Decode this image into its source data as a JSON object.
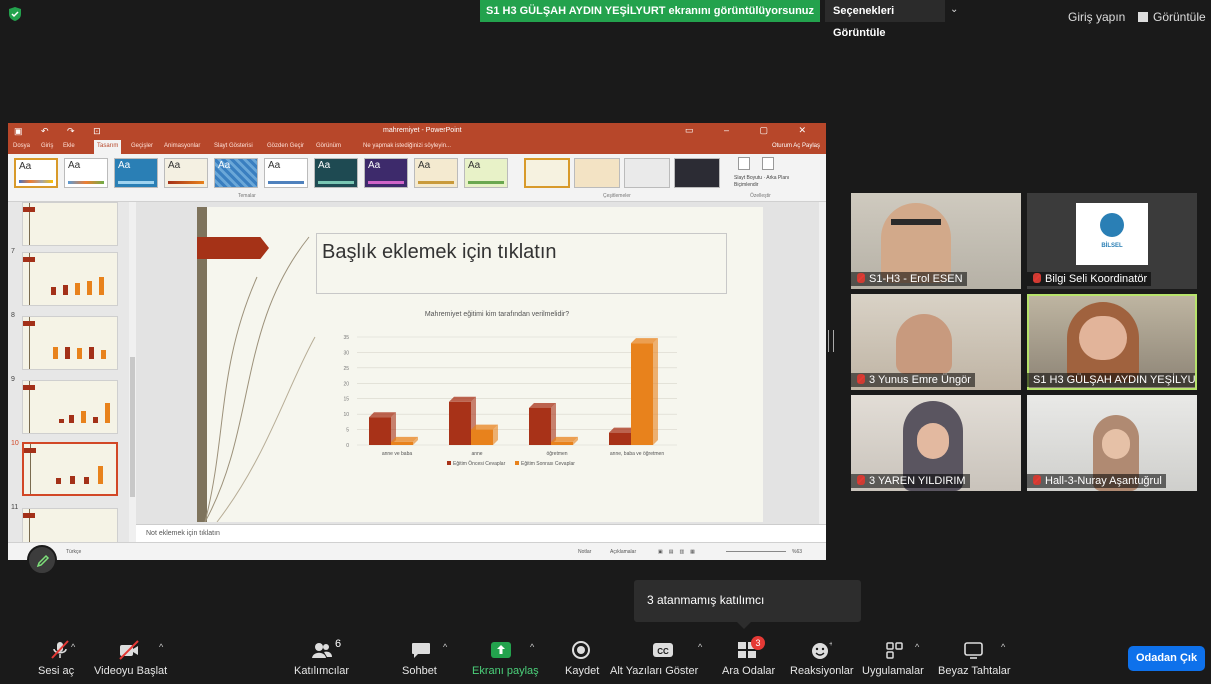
{
  "topbar": {
    "share_banner": "S1 H3 GÜLŞAH AYDIN YEŞİLYURT ekranını görüntülüyorsunuz",
    "options_label": "Seçenekleri Görüntüle",
    "signin_label": "Giriş yapın",
    "view_label": "Görüntüle"
  },
  "ppt": {
    "window_title": "mahremiyet - PowerPoint",
    "tabs": [
      "Dosya",
      "Giriş",
      "Ekle",
      "Tasarım",
      "Geçişler",
      "Animasyonlar",
      "Slayt Gösterisi",
      "Gözden Geçir",
      "Görünüm",
      "Ne yapmak istediğinizi söyleyin..."
    ],
    "active_tab": "Tasarım",
    "tabs_right": "Oturum Aç  Paylaş",
    "theme_label": "Aa",
    "group_themes": "Temalar",
    "group_variants": "Çeşitlemeler",
    "group_customize": "Özelleştir",
    "customize_btn1": "Slayt Boyutu",
    "customize_btn2": "Arka Planı Biçimlendir",
    "thumb_numbers": [
      "7",
      "8",
      "9",
      "10",
      "11"
    ],
    "slide_title": "Başlık eklemek için tıklatın",
    "notes_placeholder": "Not eklemek için tıklatın",
    "status_language": "Türkçe",
    "status_notes": "Notlar",
    "status_comments": "Açıklamalar",
    "status_zoom": "%63"
  },
  "chart_data": {
    "type": "bar",
    "title": "Mahremiyet eğitimi kim tarafından verilmelidir?",
    "categories": [
      "anne ve baba",
      "anne",
      "öğretmen",
      "anne, baba ve öğretmen"
    ],
    "series": [
      {
        "name": "Eğitim Öncesi Cevaplar",
        "values": [
          9,
          14,
          12,
          4
        ],
        "color": "#a83218"
      },
      {
        "name": "Eğitim Sonrası Cevaplar",
        "values": [
          1,
          5,
          1,
          33
        ],
        "color": "#e8821c"
      }
    ],
    "ylim": [
      0,
      35
    ],
    "yticks": [
      "0",
      "5",
      "10",
      "15",
      "20",
      "25",
      "30",
      "35"
    ],
    "legend": "bottom"
  },
  "participants": [
    {
      "name": "S1-H3 - Erol ESEN"
    },
    {
      "name": "Bilgi Seli Koordinatör",
      "logo_text": "BİLSEL"
    },
    {
      "name": "3 Yunus Emre Üngör"
    },
    {
      "name": "S1 H3 GÜLŞAH AYDIN YEŞİLYU..."
    },
    {
      "name": "3 YAREN YILDIRIM"
    },
    {
      "name": "Hall-3-Nuray Aşantuğrul"
    }
  ],
  "tooltip": "3 atanmamış katılımcı",
  "toolbar": {
    "mute": "Sesi aç",
    "video": "Videoyu Başlat",
    "participants": "Katılımcılar",
    "participants_count": "6",
    "chat": "Sohbet",
    "share": "Ekranı paylaş",
    "record": "Kaydet",
    "captions": "Alt Yazıları Göster",
    "breakout": "Ara Odalar",
    "breakout_badge": "3",
    "reactions": "Reaksiyonlar",
    "apps": "Uygulamalar",
    "whiteboard": "Beyaz Tahtalar",
    "leave": "Odadan Çık"
  }
}
